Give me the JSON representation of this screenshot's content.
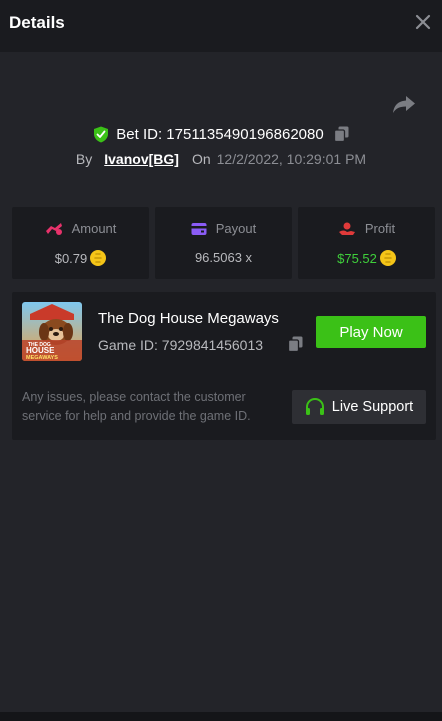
{
  "header": {
    "title": "Details"
  },
  "bet": {
    "label": "Bet ID: 1751135490196862080",
    "by_label": "By",
    "user": "Ivanov[BG]",
    "on_label": "On",
    "date": "12/2/2022, 10:29:01 PM"
  },
  "stats": {
    "amount": {
      "label": "Amount",
      "value": "$0.79"
    },
    "payout": {
      "label": "Payout",
      "value": "96.5063 x"
    },
    "profit": {
      "label": "Profit",
      "value": "$75.52"
    }
  },
  "game": {
    "thumb_text_1": "THE DOG",
    "thumb_text_2": "HOUSE",
    "thumb_text_3": "MEGAWAYS",
    "name": "The Dog House Megaways",
    "id_label": "Game ID: 7929841456013",
    "play_label": "Play Now",
    "support_text": "Any issues, please contact the customer service for help and provide the game ID.",
    "support_label": "Live Support"
  },
  "colors": {
    "background": "#232429",
    "panel": "#1a1b1f",
    "accent_green": "#3bc117",
    "profit_green": "#3fcf3b",
    "amount_pink": "#e8326b",
    "payout_purple": "#8b5cf6",
    "profit_red": "#e03a3a",
    "coin_gold": "#f5c518"
  },
  "icons": {
    "close": "close-icon",
    "share": "share-icon",
    "shield": "shield-check-icon",
    "copy": "copy-icon",
    "amount": "amount-icon",
    "payout": "wallet-icon",
    "profit": "profit-icon",
    "coin": "coin-icon",
    "headset": "headset-icon"
  }
}
